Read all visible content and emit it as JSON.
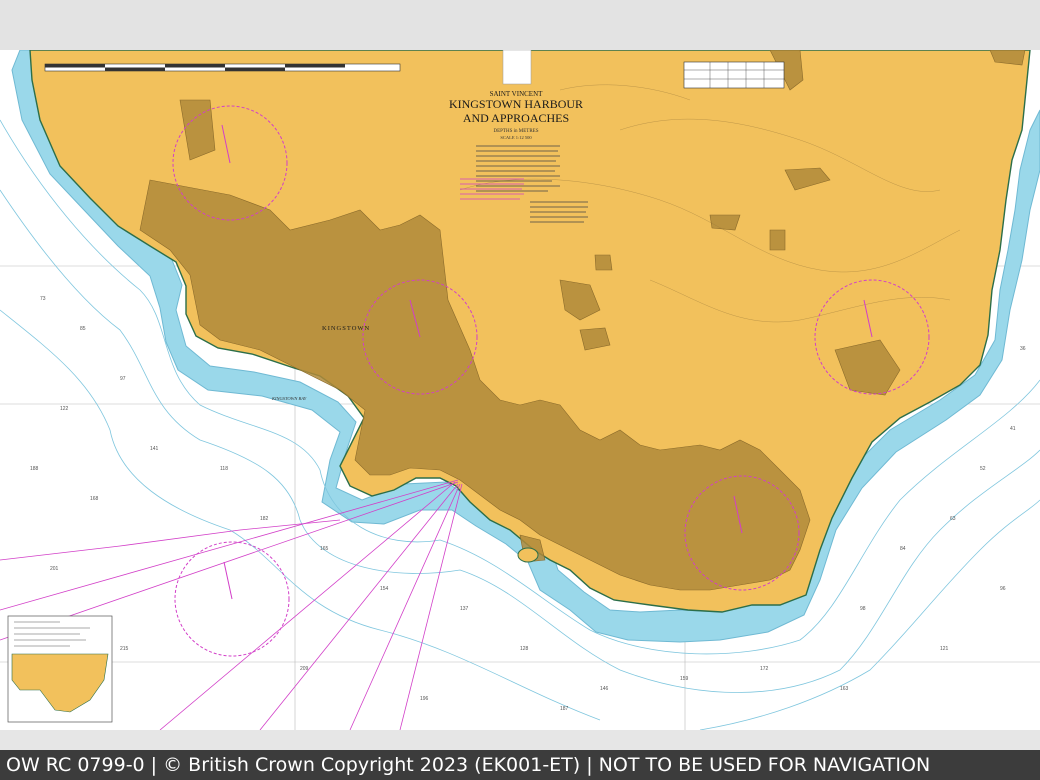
{
  "chart": {
    "title_line1": "SAINT VINCENT",
    "title_line2": "KINGSTOWN HARBOUR",
    "title_line3": "AND APPROACHES",
    "depths_label": "DEPTHS in METRES",
    "scale_label": "SCALE 1:12 500"
  },
  "places": {
    "kingstown": "KINGSTOWN",
    "kingstown_bay": "KINGSTOWN BAY"
  },
  "colors": {
    "land": "#f2c15c",
    "built_up": "#b08a3a",
    "shallow": "#9ad8ea",
    "sea": "#ffffff",
    "magenta": "#d23fc8"
  },
  "footer": {
    "text": "OW RC 0799-0 | © British Crown Copyright 2023 (EK001-ET) | NOT TO BE USED FOR NAVIGATION"
  }
}
